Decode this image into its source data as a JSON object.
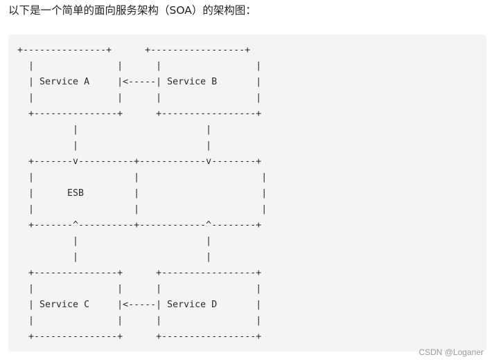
{
  "intro_text": "以下是一个简单的面向服务架构（SOA）的架构图：",
  "diagram": {
    "language": "text",
    "lines": [
      "+---------------+      +-----------------+",
      "  |               |      |                 |",
      "  | Service A     |<-----| Service B       |",
      "  |               |      |                 |",
      "  +---------------+      +-----------------+",
      "          |                       |",
      "          |                       |",
      "  +-------v----------+------------v--------+",
      "  |                  |                      |",
      "  |      ESB         |                      |",
      "  |                  |                      |",
      "  +-------^----------+------------^--------+",
      "          |                       |",
      "          |                       |",
      "  +---------------+      +-----------------+",
      "  |               |      |                 |",
      "  | Service C     |<-----| Service D       |",
      "  |               |      |                 |",
      "  +---------------+      +-----------------+"
    ],
    "components": [
      "Service A",
      "Service B",
      "ESB",
      "Service C",
      "Service D"
    ]
  },
  "watermark": "CSDN @Loganer",
  "colors": {
    "code_background": "#f4f4f4",
    "text": "#222222",
    "watermark": "#999999"
  }
}
